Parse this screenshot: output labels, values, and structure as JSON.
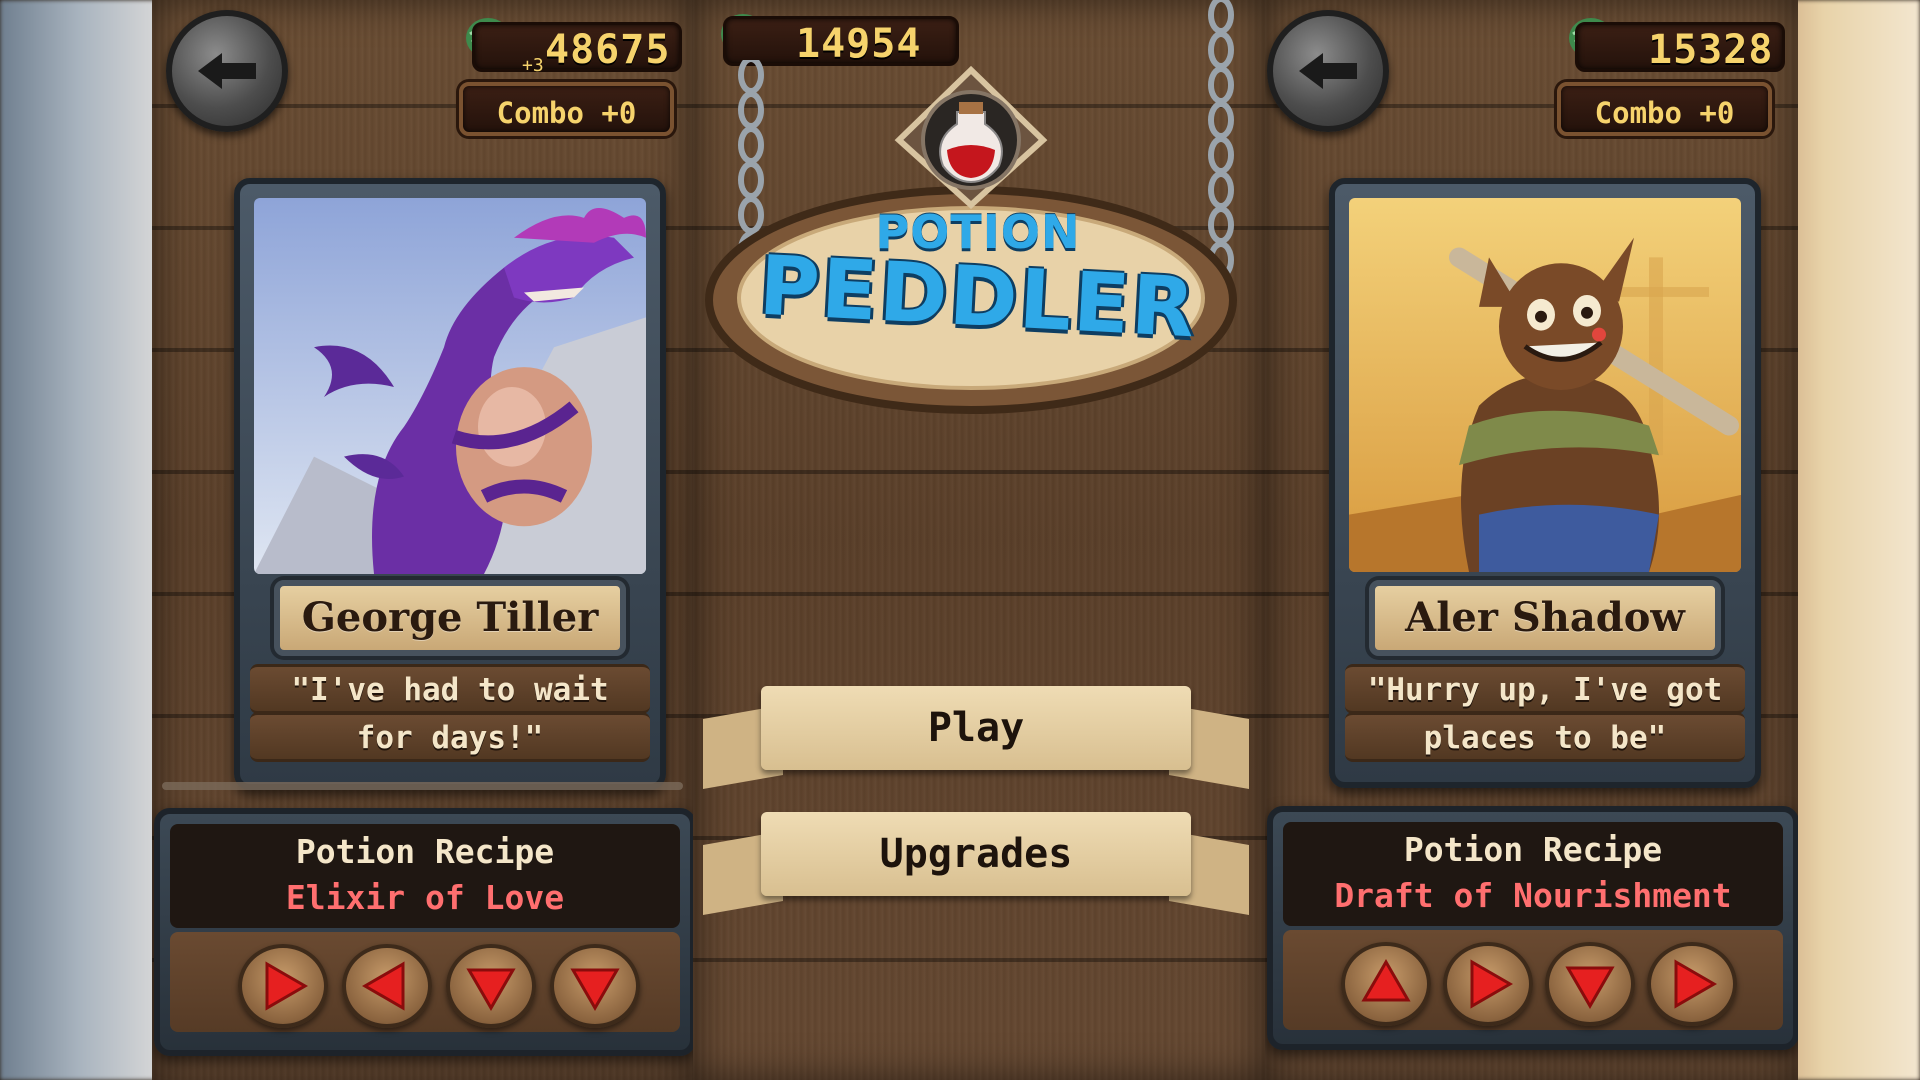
{
  "left_panel": {
    "coins": "48675",
    "coin_bonus": "+3",
    "combo": "Combo +0",
    "customer": {
      "name": "George Tiller",
      "quote_line1": "\"I've had to wait",
      "quote_line2": "for days!\""
    },
    "recipe": {
      "title": "Potion Recipe",
      "name": "Elixir of Love",
      "arrows": [
        "right",
        "left",
        "down",
        "down"
      ]
    }
  },
  "center_panel": {
    "coins": "14954",
    "logo_line1": "POTION",
    "logo_line2": "PEDDLER",
    "menu": {
      "play_label": "Play",
      "upgrades_label": "Upgrades"
    }
  },
  "right_panel": {
    "coins": "15328",
    "combo": "Combo +0",
    "customer": {
      "name": "Aler Shadow",
      "quote_line1": "\"Hurry up, I've got",
      "quote_line2": "places to be\""
    },
    "recipe": {
      "title": "Potion Recipe",
      "name": "Draft of Nourishment",
      "arrows": [
        "up",
        "right",
        "down",
        "right"
      ]
    }
  },
  "colors": {
    "recipe_name": "#ff6f6f",
    "coin_text": "#f6d36c",
    "logo_blue": "#2fa9e8"
  }
}
